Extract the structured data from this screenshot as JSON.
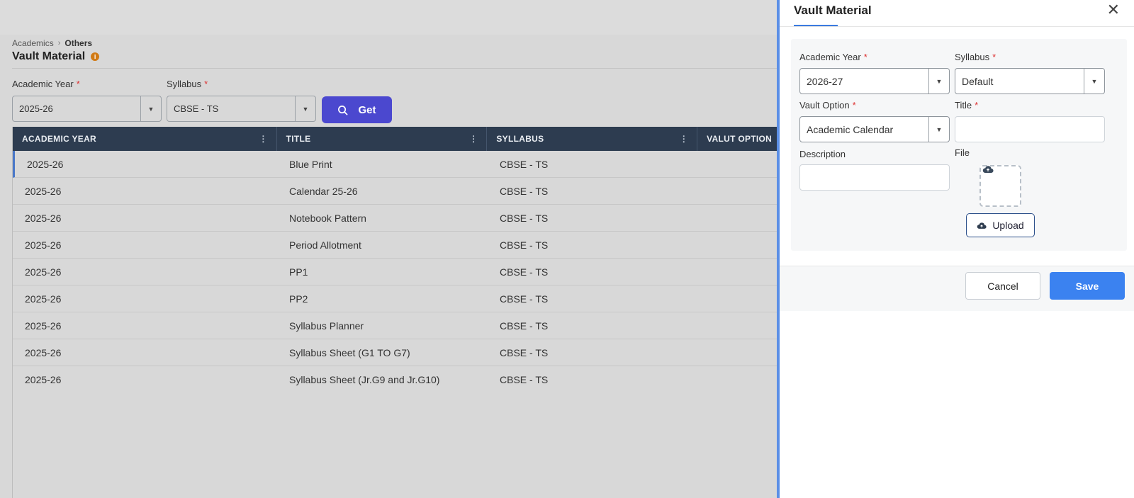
{
  "breadcrumb": {
    "parent": "Academics",
    "current": "Others"
  },
  "page": {
    "title": "Vault Material",
    "info_icon": "i"
  },
  "filters": {
    "academic_year": {
      "label": "Academic Year",
      "value": "2025-26"
    },
    "syllabus": {
      "label": "Syllabus",
      "value": "CBSE - TS"
    },
    "required_mark": "*",
    "get_button": "Get"
  },
  "grid": {
    "columns": [
      "ACADEMIC YEAR",
      "TITLE",
      "SYLLABUS",
      "VALUT OPTION"
    ],
    "rows": [
      {
        "year": "2025-26",
        "title": "Blue Print",
        "syllabus": "CBSE - TS"
      },
      {
        "year": "2025-26",
        "title": "Calendar 25-26",
        "syllabus": "CBSE - TS"
      },
      {
        "year": "2025-26",
        "title": "Notebook Pattern",
        "syllabus": "CBSE - TS"
      },
      {
        "year": "2025-26",
        "title": "Period Allotment",
        "syllabus": "CBSE - TS"
      },
      {
        "year": "2025-26",
        "title": "PP1",
        "syllabus": "CBSE - TS"
      },
      {
        "year": "2025-26",
        "title": "PP2",
        "syllabus": "CBSE - TS"
      },
      {
        "year": "2025-26",
        "title": "Syllabus Planner",
        "syllabus": "CBSE - TS"
      },
      {
        "year": "2025-26",
        "title": "Syllabus Sheet (G1 TO G7)",
        "syllabus": "CBSE - TS"
      },
      {
        "year": "2025-26",
        "title": "Syllabus Sheet (Jr.G9 and Jr.G10)",
        "syllabus": "CBSE - TS"
      }
    ]
  },
  "drawer": {
    "title": "Vault Material",
    "close_icon": "✕",
    "academic_year": {
      "label": "Academic Year",
      "value": "2026-27"
    },
    "syllabus": {
      "label": "Syllabus",
      "value": "Default"
    },
    "vault_option": {
      "label": "Vault Option",
      "value": "Academic Calendar"
    },
    "title_field": {
      "label": "Title",
      "value": ""
    },
    "description": {
      "label": "Description",
      "value": ""
    },
    "file": {
      "label": "File",
      "upload_label": "Upload"
    },
    "cancel_label": "Cancel",
    "save_label": "Save"
  },
  "colors": {
    "header_bg": "#2d3c50",
    "get_button": "#4b48cf",
    "save_button": "#3b82f0",
    "drawer_accent": "#5b8fe6",
    "required": "#dd3333"
  }
}
